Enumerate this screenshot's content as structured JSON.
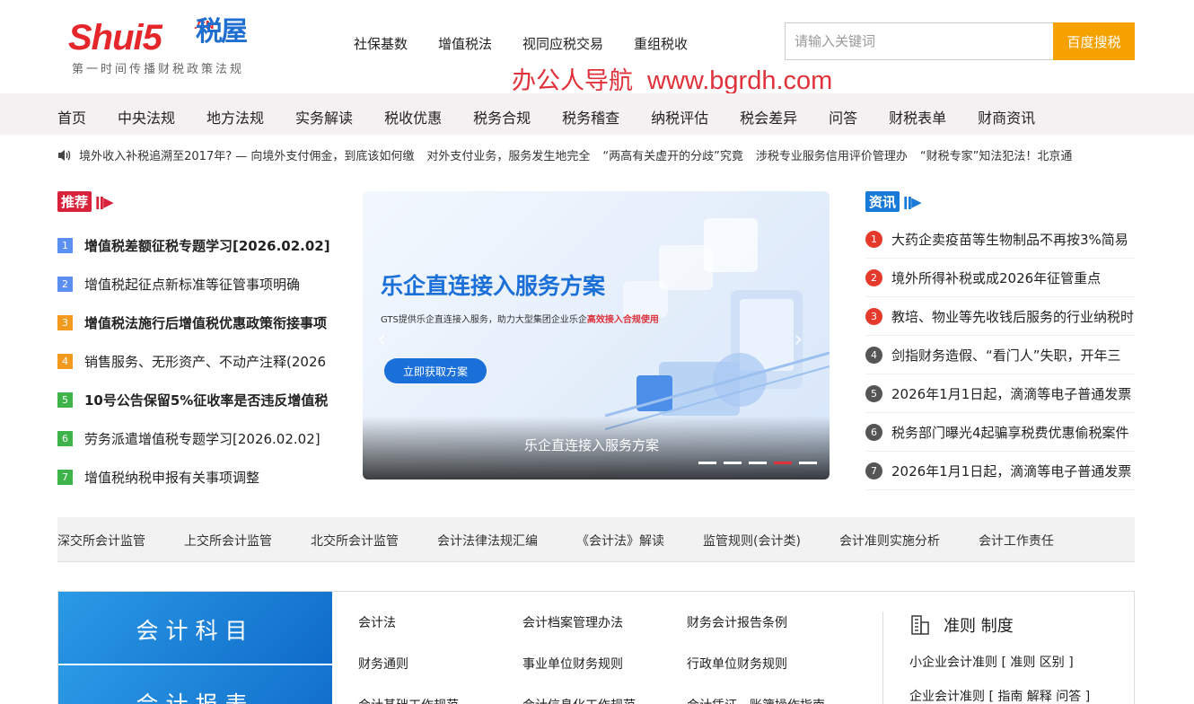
{
  "logo": {
    "main": "Shui5",
    "cn": ".CN",
    "house": "税屋",
    "tagline": "第一时间传播财税政策法规"
  },
  "topnav": [
    "社保基数",
    "增值税法",
    "视同应税交易",
    "重组税收"
  ],
  "watermark": {
    "text": "办公人导航",
    "url": "www.bgrdh.com"
  },
  "search": {
    "placeholder": "请输入关键词",
    "button": "百度搜税"
  },
  "mainnav": [
    "首页",
    "中央法规",
    "地方法规",
    "实务解读",
    "税收优惠",
    "税务合规",
    "税务稽查",
    "纳税评估",
    "税会差异",
    "问答",
    "财税表单",
    "财商资讯"
  ],
  "ticker": [
    "境外收入补税追溯至2017年? — 向境外支付佣金，到底该如何缴",
    "对外支付业务，服务发生地完全",
    "“两高有关虚开的分歧”究竟",
    "涉税专业服务信用评价管理办",
    "“财税专家”知法犯法！北京通"
  ],
  "recommend": {
    "badge": "推荐",
    "items": [
      {
        "n": "1",
        "text": "增值税差额征税专题学习[2026.02.02]",
        "bold": true,
        "color": "#5b8ff0"
      },
      {
        "n": "2",
        "text": "增值税起征点新标准等征管事项明确",
        "bold": false,
        "color": "#5b8ff0"
      },
      {
        "n": "3",
        "text": "增值税法施行后增值税优惠政策衔接事项",
        "bold": true,
        "color": "#f39a1e"
      },
      {
        "n": "4",
        "text": "销售服务、无形资产、不动产注释(2026",
        "bold": false,
        "color": "#f39a1e"
      },
      {
        "n": "5",
        "text": "10号公告保留5%征收率是否违反增值税",
        "bold": true,
        "color": "#3db34a"
      },
      {
        "n": "6",
        "text": "劳务派遣增值税专题学习[2026.02.02]",
        "bold": false,
        "color": "#3db34a"
      },
      {
        "n": "7",
        "text": "增值税纳税申报有关事项调整",
        "bold": false,
        "color": "#3db34a"
      }
    ]
  },
  "banner": {
    "title": "乐企直连接入服务方案",
    "sub_prefix": "GTS提供乐企直连接入服务，助力大型集团企业乐企",
    "sub_highlight": "高效接入合规使用",
    "button": "立即获取方案",
    "caption": "乐企直连接入服务方案",
    "slides": 5,
    "active_slide": 4
  },
  "news": {
    "badge": "资讯",
    "items": [
      {
        "n": "1",
        "text": "大药企卖疫苗等生物制品不再按3%简易",
        "color": "#e5392c"
      },
      {
        "n": "2",
        "text": "境外所得补税或成2026年征管重点",
        "color": "#e5392c"
      },
      {
        "n": "3",
        "text": "教培、物业等先收钱后服务的行业纳税时",
        "color": "#e5392c"
      },
      {
        "n": "4",
        "text": "剑指财务造假、“看门人”失职，开年三",
        "color": "#555555"
      },
      {
        "n": "5",
        "text": "2026年1月1日起，滴滴等电子普通发票",
        "color": "#555555"
      },
      {
        "n": "6",
        "text": "税务部门曝光4起骗享税费优惠偷税案件",
        "color": "#555555"
      },
      {
        "n": "7",
        "text": "2026年1月1日起，滴滴等电子普通发票",
        "color": "#555555"
      }
    ]
  },
  "catbar": [
    "深交所会计监管",
    "上交所会计监管",
    "北交所会计监管",
    "会计法律法规汇编",
    "《会计法》解读",
    "监管规则(会计类)",
    "会计准则实施分析",
    "会计工作责任"
  ],
  "panel": {
    "tiles": [
      "会计科目",
      "会计报表"
    ],
    "links": [
      "会计法",
      "会计档案管理办法",
      "财务会计报告条例",
      "财务通则",
      "事业单位财务规则",
      "行政单位财务规则",
      "会计基础工作规范",
      "会计信息化工作规范",
      "会计凭证、账簿操作指南"
    ],
    "rules_title": "准则 制度",
    "rules_rows": [
      "小企业会计准则 [ 准则 区别 ]",
      "企业会计准则 [ 指南 解释 问答 ]"
    ]
  }
}
